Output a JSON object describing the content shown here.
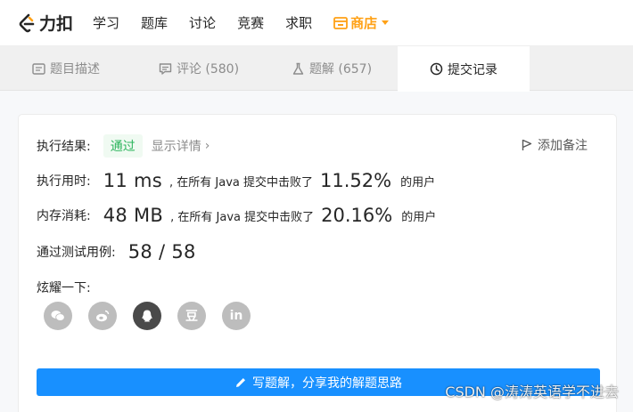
{
  "brand": {
    "name": "力扣",
    "accent": "#ffa116"
  },
  "nav": {
    "items": [
      "学习",
      "题库",
      "讨论",
      "竞赛",
      "求职"
    ],
    "store": "商店"
  },
  "tabs": {
    "description": "题目描述",
    "comments": "评论 (580)",
    "solutions": "题解 (657)",
    "submissions": "提交记录"
  },
  "result": {
    "status_label": "执行结果:",
    "status_value": "通过",
    "details_link": "显示详情",
    "add_note": "添加备注",
    "runtime_label": "执行用时:",
    "runtime_value": "11 ms",
    "runtime_text": ", 在所有 Java 提交中击败了",
    "runtime_percent": "11.52%",
    "runtime_suffix": "的用户",
    "memory_label": "内存消耗:",
    "memory_value": "48 MB",
    "memory_text": ", 在所有 Java 提交中击败了",
    "memory_percent": "20.16%",
    "memory_suffix": "的用户",
    "tests_label": "通过测试用例:",
    "tests_value": "58 / 58",
    "share_label": "炫耀一下:"
  },
  "share_icons": [
    "wechat-icon",
    "weibo-icon",
    "qq-icon",
    "douban-icon",
    "linkedin-icon"
  ],
  "douban_glyph": "豆",
  "linkedin_glyph": "in",
  "write_solution": "写题解，分享我的解题思路",
  "watermark": "CSDN @涛涛英语学不进去"
}
